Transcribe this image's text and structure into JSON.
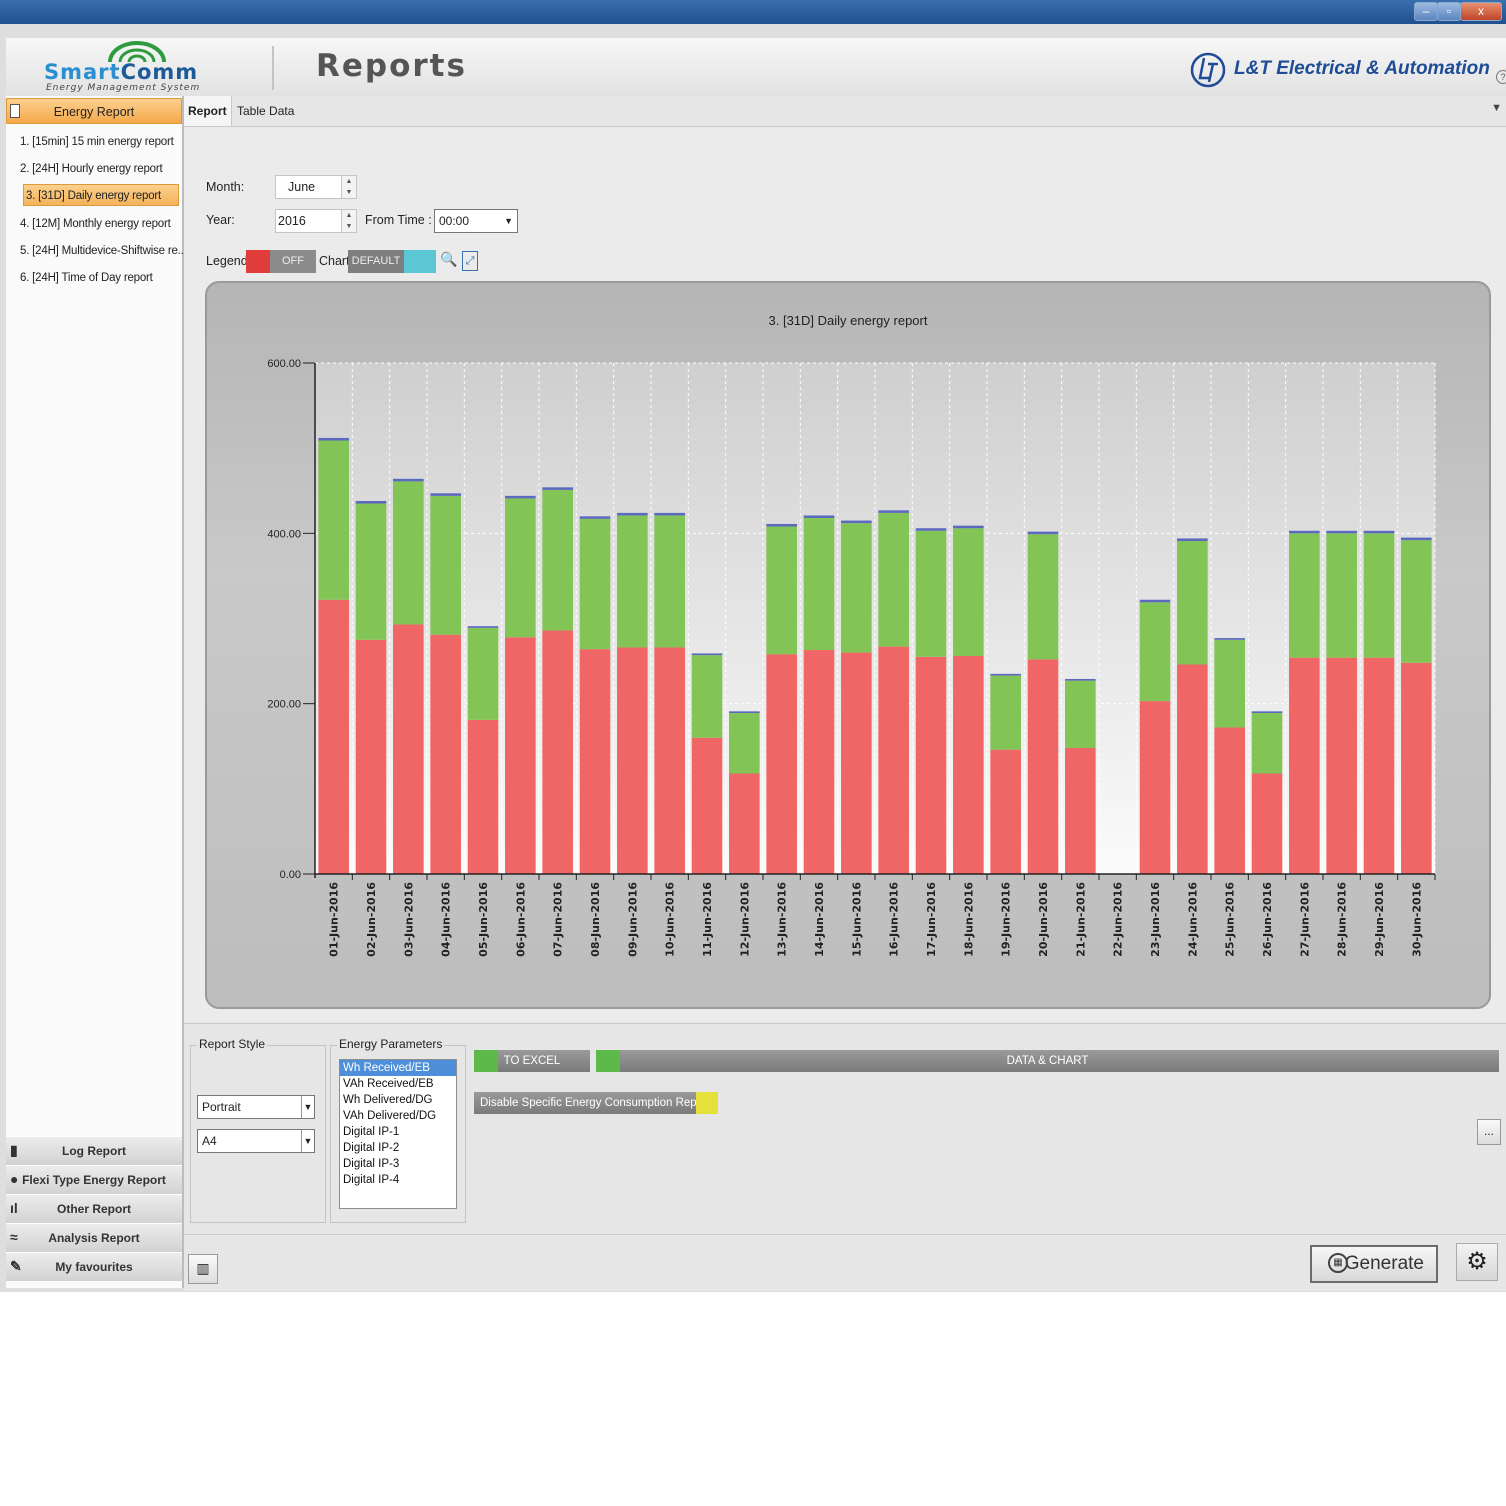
{
  "window": {
    "minimize_glyph": "–",
    "restore_glyph": "▫",
    "close_glyph": "x"
  },
  "header": {
    "logo_smart": "Smart",
    "logo_comm": "Comm",
    "logo_subtitle": "Energy Management System",
    "title": "Reports",
    "brand": "L&T Electrical & Automation",
    "help_glyph": "?"
  },
  "sidebar": {
    "section_title": "Energy Report",
    "items": [
      {
        "label": "1.  [15min] 15 min energy report"
      },
      {
        "label": "2.  [24H] Hourly energy report"
      },
      {
        "label": "3.  [31D] Daily energy report"
      },
      {
        "label": "4.  [12M] Monthly energy report"
      },
      {
        "label": "5.  [24H] Multidevice-Shiftwise re..."
      },
      {
        "label": "6.  [24H] Time of Day report"
      }
    ],
    "selected_index": 2,
    "bottom": [
      {
        "label": "Log Report",
        "icon": "document-icon"
      },
      {
        "label": "Flexi Type Energy Report",
        "icon": "flexi-icon"
      },
      {
        "label": "Other Report",
        "icon": "bar-chart-icon"
      },
      {
        "label": "Analysis Report",
        "icon": "analysis-icon"
      },
      {
        "label": "My favourites",
        "icon": "pin-icon"
      }
    ]
  },
  "tabs": [
    {
      "label": "Report",
      "active": true
    },
    {
      "label": "Table Data",
      "active": false
    }
  ],
  "tabs_dropdown_glyph": "▼",
  "controls": {
    "month_label": "Month:",
    "month_value": "June",
    "year_label": "Year:",
    "year_value": "2016",
    "from_time_label": "From Time :",
    "from_time_value": "00:00",
    "legend_label": "Legend",
    "legend_toggle": "OFF",
    "chart_label": "Chart",
    "chart_toggle": "DEFAULT",
    "zoom_glyph": "🔍",
    "expand_glyph": "⤢"
  },
  "colors": {
    "received": "#f06565",
    "delivered": "#82c456",
    "top_cap": "#5b6abf",
    "accent_orange": "#f4a94a"
  },
  "chart_data": {
    "type": "bar",
    "stacked": true,
    "title": "3.  [31D] Daily energy report",
    "ylim": [
      0,
      600
    ],
    "yticks": [
      "0.00",
      "200.00",
      "400.00",
      "600.00"
    ],
    "grid": true,
    "categories": [
      "01-Jun-2016",
      "02-Jun-2016",
      "03-Jun-2016",
      "04-Jun-2016",
      "05-Jun-2016",
      "06-Jun-2016",
      "07-Jun-2016",
      "08-Jun-2016",
      "09-Jun-2016",
      "10-Jun-2016",
      "11-Jun-2016",
      "12-Jun-2016",
      "13-Jun-2016",
      "14-Jun-2016",
      "15-Jun-2016",
      "16-Jun-2016",
      "17-Jun-2016",
      "18-Jun-2016",
      "19-Jun-2016",
      "20-Jun-2016",
      "21-Jun-2016",
      "22-Jun-2016",
      "23-Jun-2016",
      "24-Jun-2016",
      "25-Jun-2016",
      "26-Jun-2016",
      "27-Jun-2016",
      "28-Jun-2016",
      "29-Jun-2016",
      "30-Jun-2016"
    ],
    "series": [
      {
        "values": [
          322,
          275,
          293,
          281,
          181,
          278,
          286,
          264,
          266,
          266,
          160,
          118,
          258,
          263,
          260,
          267,
          255,
          256,
          146,
          252,
          148,
          0,
          203,
          246,
          172,
          118,
          254,
          254,
          254,
          248
        ]
      },
      {
        "values": [
          187,
          160,
          168,
          163,
          108,
          163,
          165,
          153,
          155,
          155,
          97,
          71,
          150,
          155,
          152,
          157,
          148,
          150,
          87,
          147,
          79,
          0,
          116,
          145,
          103,
          71,
          146,
          146,
          146,
          144
        ]
      },
      {
        "values": [
          3,
          3,
          3,
          3,
          2,
          3,
          3,
          3,
          3,
          3,
          2,
          2,
          3,
          3,
          3,
          3,
          3,
          3,
          2,
          3,
          2,
          0,
          3,
          3,
          2,
          2,
          3,
          3,
          3,
          3
        ]
      }
    ]
  },
  "report_style": {
    "title": "Report Style",
    "orientation": "Portrait",
    "paper": "A4"
  },
  "energy_parameters": {
    "title": "Energy Parameters",
    "items": [
      "Wh Received/EB",
      "VAh Received/EB",
      "Wh Delivered/DG",
      "VAh Delivered/DG",
      "Digital IP-1",
      "Digital IP-2",
      "Digital IP-3",
      "Digital IP-4"
    ],
    "selected_index": 0
  },
  "actions": {
    "to_excel": "TO EXCEL",
    "data_chart": "DATA & CHART",
    "disable_specific": "Disable Specific Energy Consumption  Report",
    "ellipsis_button": "...",
    "generate": "Generate",
    "gear_glyph": "⚙"
  }
}
